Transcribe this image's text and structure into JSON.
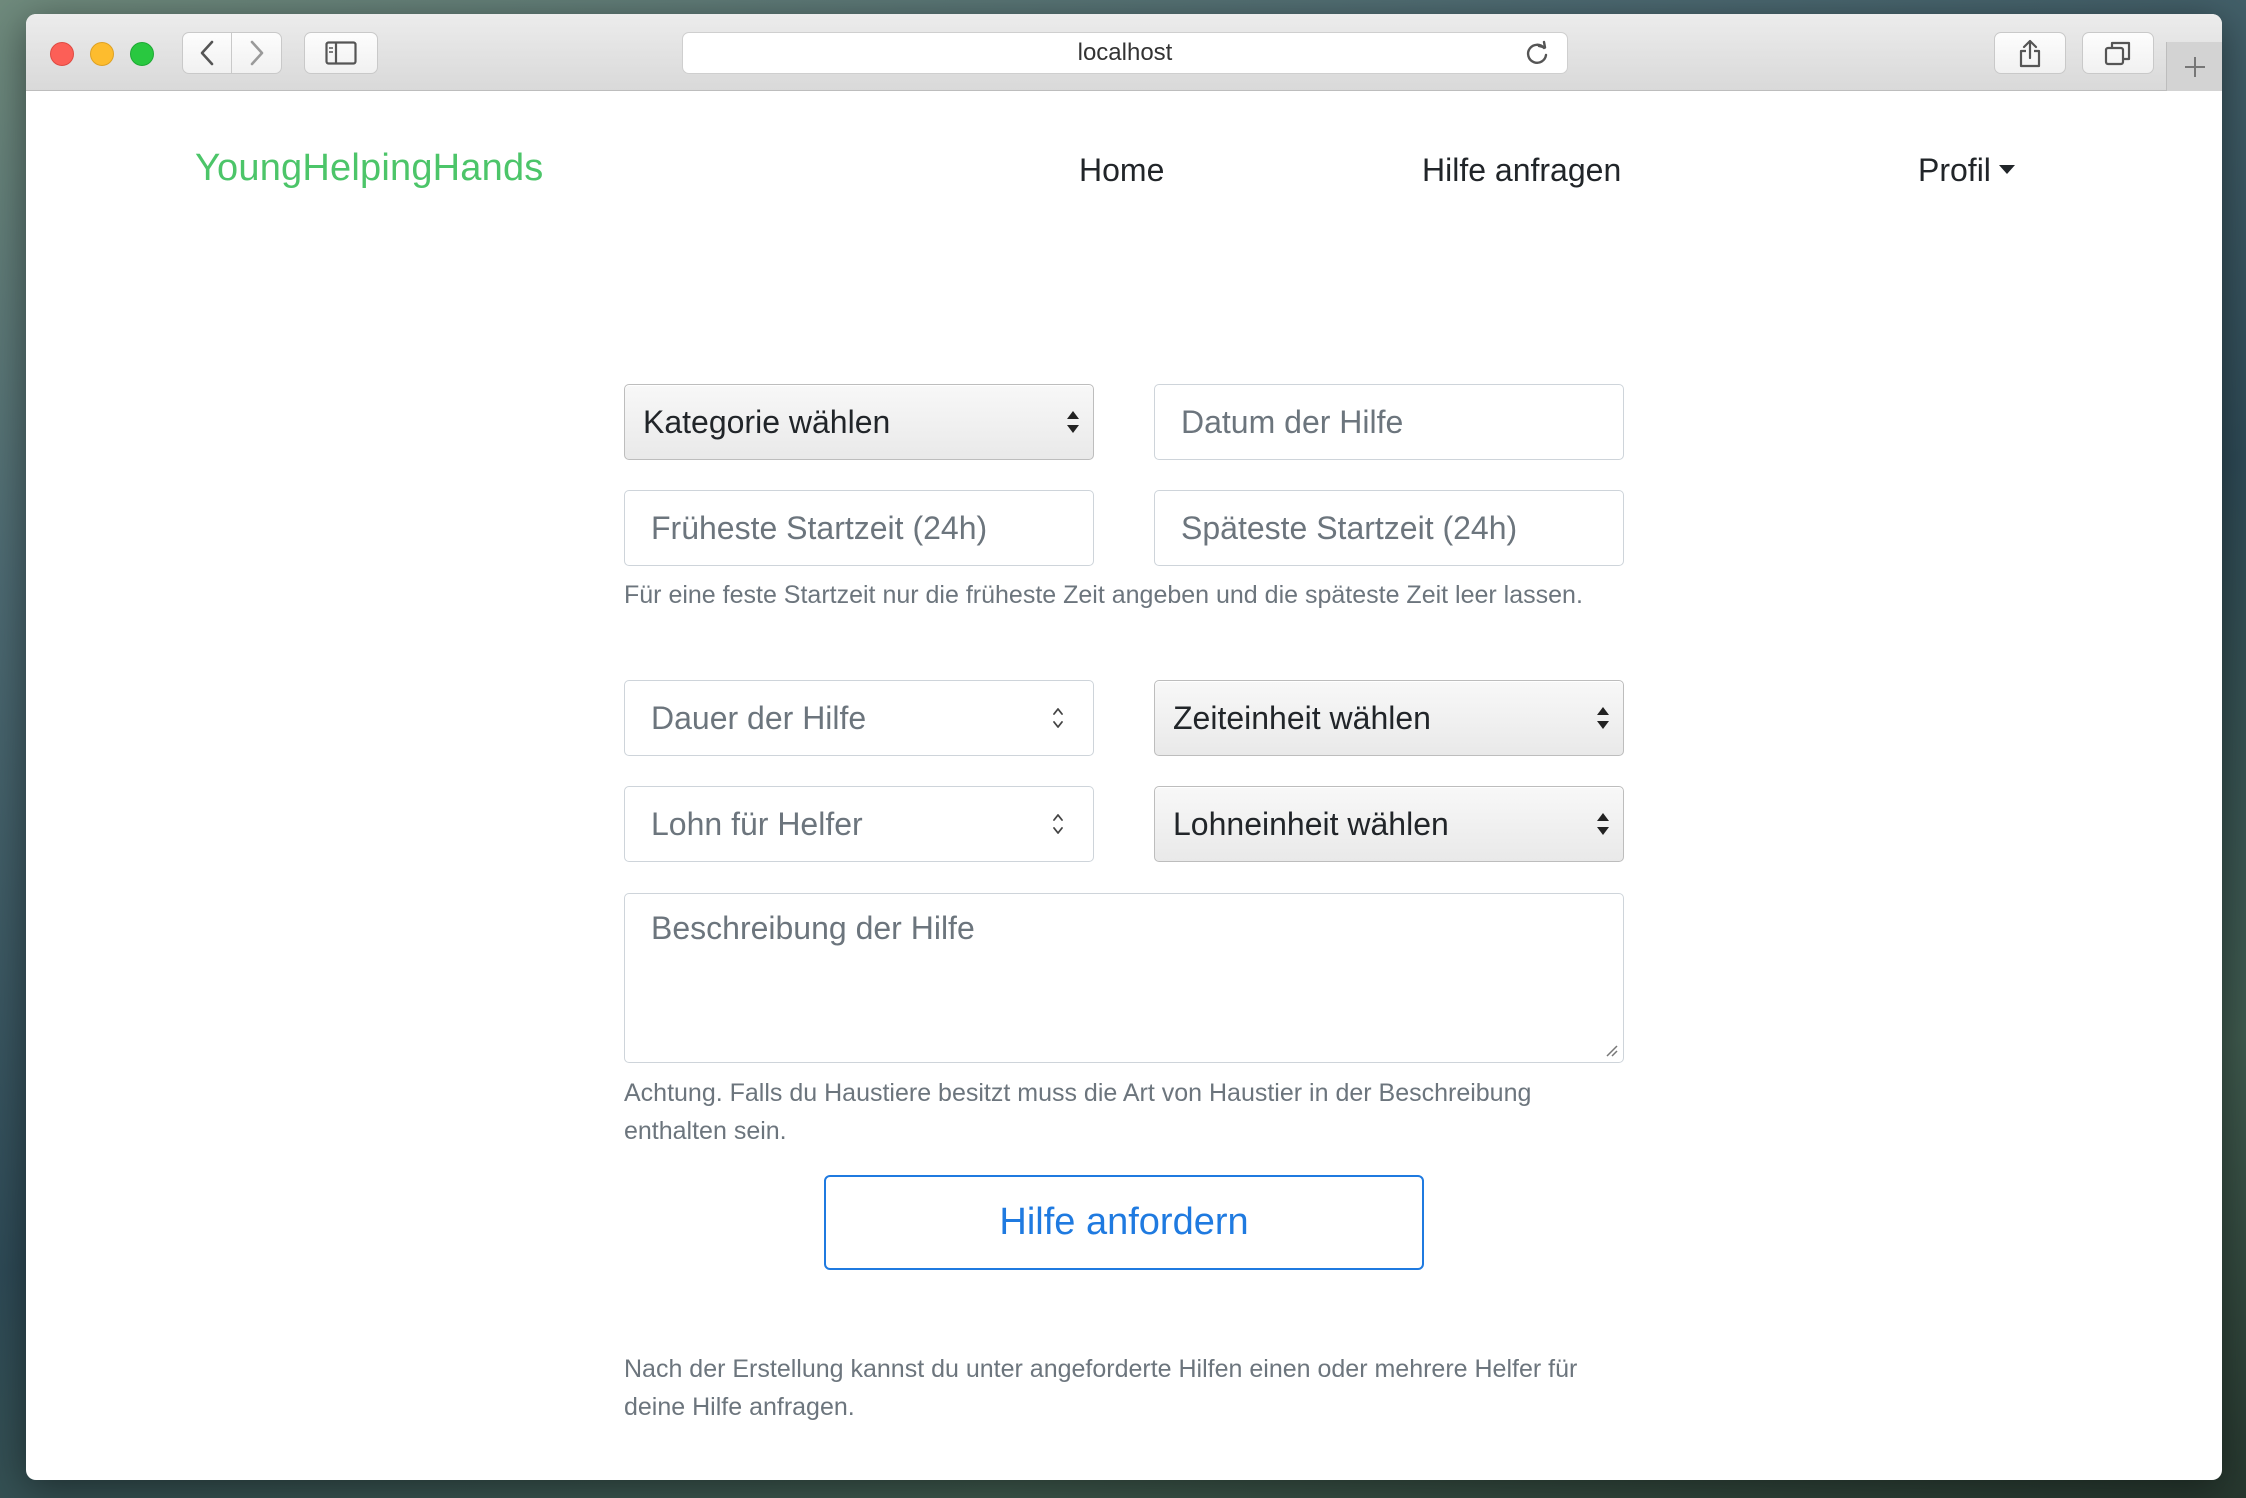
{
  "browser": {
    "address": "localhost"
  },
  "nav": {
    "brand": "YoungHelpingHands",
    "home": "Home",
    "request_help": "Hilfe anfragen",
    "profile": "Profil"
  },
  "form": {
    "category_select": "Kategorie wählen",
    "date_placeholder": "Datum der Hilfe",
    "earliest_start_placeholder": "Früheste Startzeit (24h)",
    "latest_start_placeholder": "Späteste Startzeit (24h)",
    "start_time_hint": "Für eine feste Startzeit nur die früheste Zeit angeben und die späteste Zeit leer lassen.",
    "duration_placeholder": "Dauer der Hilfe",
    "time_unit_select": "Zeiteinheit wählen",
    "wage_placeholder": "Lohn für Helfer",
    "wage_unit_select": "Lohneinheit wählen",
    "description_placeholder": "Beschreibung der Hilfe",
    "pet_hint": "Achtung. Falls du Haustiere besitzt muss die Art von Haustier in der Beschreibung enthalten sein.",
    "submit_label": "Hilfe anfordern",
    "footer_hint": "Nach der Erstellung kannst du unter angeforderte Hilfen einen oder mehrere Helfer für deine Hilfe anfragen."
  },
  "colors": {
    "brand": "#4cc569",
    "primary": "#1f7ae0",
    "muted_text": "#6c757d"
  },
  "icons": [
    "back-arrow-icon",
    "forward-arrow-icon",
    "sidebar-icon",
    "reload-icon",
    "share-icon",
    "tabs-icon",
    "plus-icon",
    "select-arrows-icon",
    "spinner-icon",
    "resize-grip-icon"
  ]
}
